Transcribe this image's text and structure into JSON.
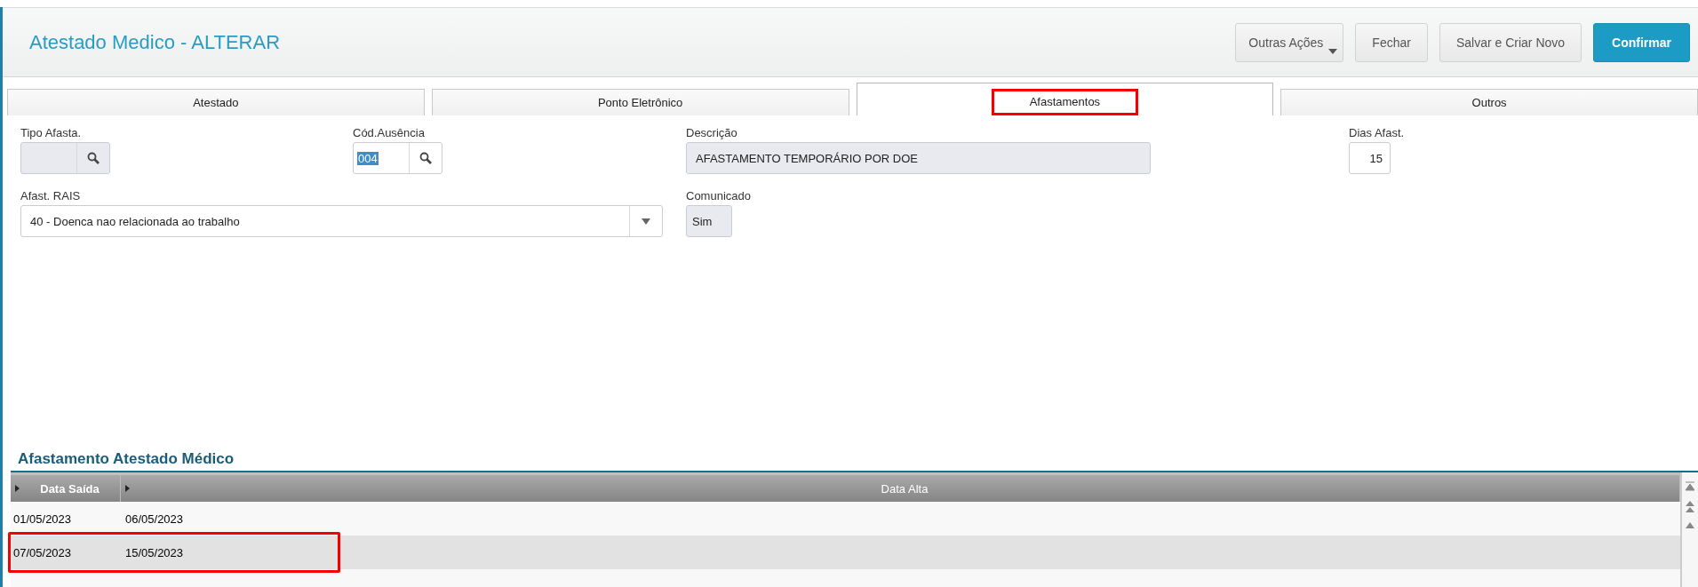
{
  "header": {
    "title": "Atestado Medico - ALTERAR",
    "buttons": [
      {
        "label": "Outras Ações",
        "kind": "dropdown"
      },
      {
        "label": "Fechar",
        "kind": "default"
      },
      {
        "label": "Salvar e Criar Novo",
        "kind": "default"
      },
      {
        "label": "Confirmar",
        "kind": "primary"
      }
    ]
  },
  "tabs": [
    {
      "label": "Atestado",
      "selected": false,
      "highlighted": false
    },
    {
      "label": "Ponto Eletrônico",
      "selected": false,
      "highlighted": false
    },
    {
      "label": "Afastamentos",
      "selected": true,
      "highlighted": true
    },
    {
      "label": "Outros",
      "selected": false,
      "highlighted": false
    }
  ],
  "fields": [
    {
      "label": "Tipo Afasta.",
      "kind": "lookup",
      "readonly": true
    },
    {
      "label": "Cód.Ausência",
      "kind": "lookup",
      "value": "004",
      "readonly": false
    },
    {
      "label": "Descrição",
      "kind": "text",
      "value": "AFASTAMENTO TEMPORÁRIO POR DOE",
      "readonly": true
    },
    {
      "label": "Dias Afast.",
      "kind": "number",
      "value": "15",
      "readonly": false
    },
    {
      "label": "Afast. RAIS",
      "kind": "select",
      "value": "40 - Doenca nao relacionada ao trabalho",
      "readonly": false
    },
    {
      "label": "Comunicado",
      "kind": "short",
      "value": "Sim",
      "readonly": true
    }
  ],
  "grid": {
    "title": "Afastamento Atestado Médico",
    "columns": [
      "Data Saída",
      "Data Alta"
    ],
    "rows": [
      {
        "cells": [
          "01/05/2023",
          "06/05/2023"
        ],
        "selected": false,
        "highlighted": false
      },
      {
        "cells": [
          "07/05/2023",
          "15/05/2023"
        ],
        "selected": true,
        "highlighted": true
      }
    ]
  }
}
